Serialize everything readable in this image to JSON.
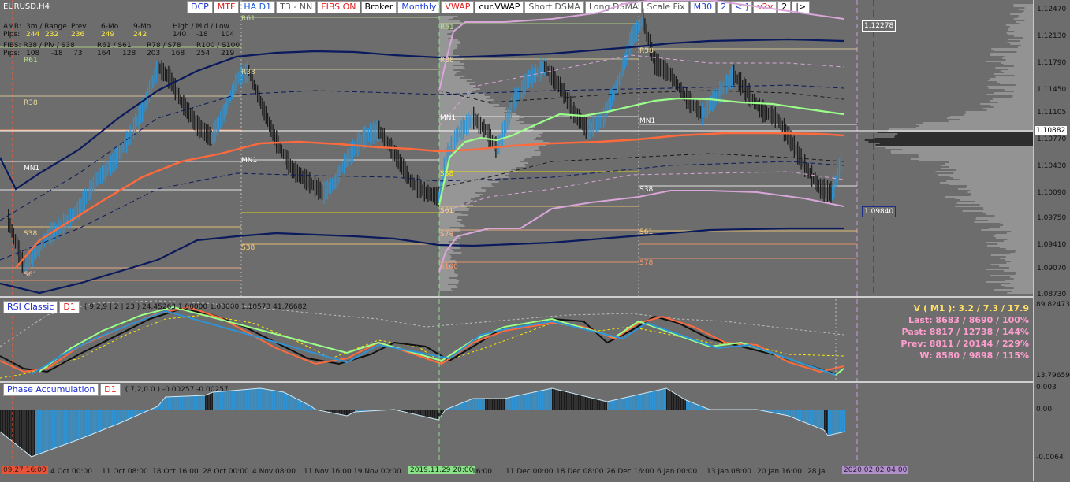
{
  "symbol": "EURUSD,H4",
  "toolbar": [
    {
      "label": "DCP",
      "color": "#1b2ccf"
    },
    {
      "label": "MTF",
      "color": "#e21f1f"
    },
    {
      "label": "HA D1",
      "color": "#1f5ad6"
    },
    {
      "label": "T3 - NN",
      "color": "#555555"
    },
    {
      "label": "FIBS ON",
      "color": "#e21f1f"
    },
    {
      "label": "Broker",
      "color": "#000000"
    },
    {
      "label": "Monthly",
      "color": "#1f3fd6"
    },
    {
      "label": "VWAP",
      "color": "#e21f1f"
    },
    {
      "label": "cur.VWAP",
      "color": "#000000"
    },
    {
      "label": "Short DSMA",
      "color": "#555555"
    },
    {
      "label": "Long DSMA",
      "color": "#555555"
    },
    {
      "label": "Scale Fix",
      "color": "#555555"
    },
    {
      "label": "M30",
      "color": "#1f3fd6"
    },
    {
      "label": "2",
      "color": "#1f3fd6"
    },
    {
      "label": "< ]",
      "color": "#1f3fd6"
    },
    {
      "label": "v2v",
      "color": "#e21f1f"
    },
    {
      "label": "2",
      "color": "#000000"
    },
    {
      "label": "|>",
      "color": "#000000"
    }
  ],
  "amr": {
    "header": [
      "AMR:",
      "3m / Range",
      "Prev",
      "6-Mo",
      "9-Mo",
      "High / Mid / Low"
    ],
    "label": "Pips:",
    "values": [
      "244",
      "232",
      "236",
      "249",
      "242",
      "140",
      "-18",
      "104"
    ]
  },
  "fibs": {
    "header": [
      "FIBS: R38 / Piv / S38",
      "R61 / S61",
      "R78 / S78",
      "R100 / S100"
    ],
    "label": "Pips:",
    "values": [
      "108",
      "-18",
      "73",
      "164",
      "128",
      "203",
      "168",
      "254",
      "219"
    ]
  },
  "levels_left": [
    "R61",
    "R38",
    "MN1",
    "S38",
    "S61"
  ],
  "levels_mid": [
    "R61",
    "R38",
    "MN1",
    "S38"
  ],
  "levels_right1": [
    "R61",
    "R38",
    "MN1",
    "S38",
    "S61",
    "S78",
    "S100"
  ],
  "levels_right2": [
    "R38",
    "MN1",
    "S38",
    "S61",
    "S78"
  ],
  "price_axis": [
    "1.12470",
    "1.12130",
    "1.11790",
    "1.11450",
    "1.11105",
    "1.10770",
    "1.10430",
    "1.10090",
    "1.09750",
    "1.09410",
    "1.09070",
    "1.08730"
  ],
  "price_tags": {
    "upper": "1.12278",
    "current": "1.10882",
    "lower": "1.09840"
  },
  "time_axis": [
    "09.27 16:00",
    "4 Oct 00:00",
    "11 Oct 08:00",
    "18 Oct 16:00",
    "28 Oct 00:00",
    "4 Nov 08:00",
    "11 Nov 16:00",
    "19 Nov 00:00",
    "2019.11.29 20:00",
    "16:00",
    "11 Dec 00:00",
    "18 Dec 08:00",
    "26 Dec 16:00",
    "6 Jan 00:00",
    "13 Jan 08:00",
    "20 Jan 16:00",
    "28 Ja",
    "2020.02.02 04:00"
  ],
  "rsi": {
    "name": "RSI Classic",
    "tf": "D1",
    "params": "( 9,2,9 | 2 | 23 ) 24.45263 1.00000 1.00000 1.10573 41.76682",
    "axis_top": "89.82473",
    "axis_bottom": "13.79659"
  },
  "phase": {
    "name": "Phase Accumulation",
    "tf": "D1",
    "params": "( 7,2,0.0 ) -0.00257 -0.00257",
    "axis": [
      "0.003",
      "0.00",
      "-0.0064"
    ]
  },
  "vstats": {
    "v": "V ( M1 ): 3.2 / 7.3 / 17.9",
    "last": "Last: 8683 / 8690 / 100%",
    "past": "Past: 8817 / 12738 / 144%",
    "prev": "Prev: 8811 / 20144 / 229%",
    "w": "W: 8580 / 9898 / 115%"
  },
  "colors": {
    "background": "#6d6d6d",
    "heikin_up": "#2d93d4",
    "heikin_down": "#1a1a1a",
    "vwap": "#ff6a3d",
    "green_line": "#9bff8a",
    "pink_band": "#d9a6d9",
    "navy_band": "#0a1a5c",
    "yellow_dash": "#ffee00",
    "vstats_yellow": "#ffe066",
    "vstats_pink": "#ff9ecf"
  }
}
